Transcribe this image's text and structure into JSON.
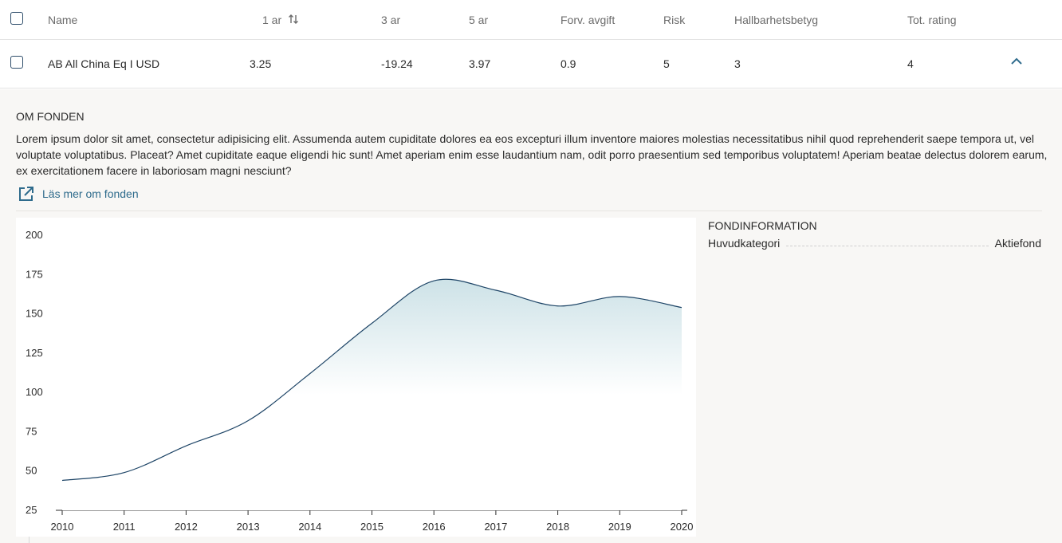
{
  "table": {
    "columns": {
      "name": "Name",
      "y1": "1 ar",
      "y3": "3 ar",
      "y5": "5 ar",
      "fee": "Forv. avgift",
      "risk": "Risk",
      "sustain": "Hallbarhetsbetyg",
      "rating": "Tot. rating"
    },
    "row": {
      "name": "AB All China Eq I USD",
      "y1": "3.25",
      "y3": "-19.24",
      "y5": "3.97",
      "fee": "0.9",
      "risk": "5",
      "sustain": "3",
      "rating": "4"
    }
  },
  "details": {
    "title": "OM FONDEN",
    "description": "Lorem ipsum dolor sit amet, consectetur adipisicing elit. Assumenda autem cupiditate dolores ea eos excepturi illum inventore maiores molestias necessitatibus nihil quod reprehenderit saepe tempora ut, vel voluptate voluptatibus. Placeat? Amet cupiditate eaque eligendi hic sunt! Amet aperiam enim esse laudantium nam, odit porro praesentium sed temporibus voluptatem! Aperiam beatae delectus dolorem earum, ex exercitationem facere in laboriosam magni nesciunt?",
    "link_label": "Läs mer om fonden"
  },
  "info": {
    "title": "FONDINFORMATION",
    "rows": [
      {
        "label": "Huvudkategori",
        "value": "Aktiefond"
      }
    ]
  },
  "colors": {
    "accent": "#2e6b8c",
    "line": "#1d4466",
    "fill": "#cfe3e8"
  },
  "chart_data": {
    "type": "area",
    "x": [
      2010,
      2011,
      2012,
      2013,
      2014,
      2015,
      2016,
      2017,
      2018,
      2019,
      2020
    ],
    "values": [
      44,
      49,
      66,
      82,
      112,
      144,
      171,
      165,
      155,
      161,
      154
    ],
    "ylim": [
      25,
      200
    ],
    "yticks": [
      25,
      50,
      75,
      100,
      125,
      150,
      175,
      200
    ],
    "grid": false
  }
}
